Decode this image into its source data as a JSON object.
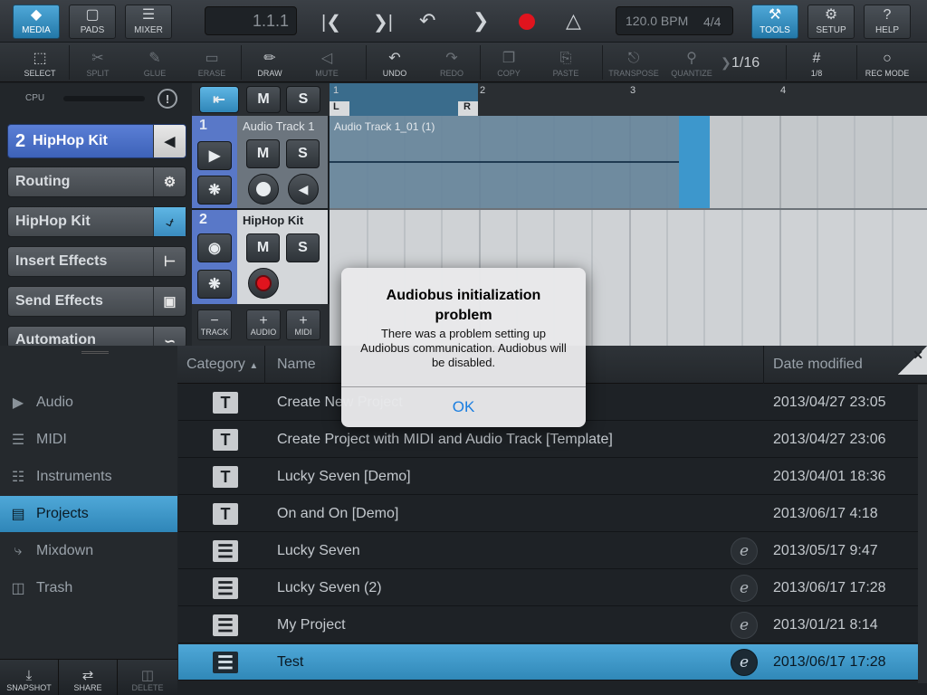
{
  "toolbar": {
    "media": "MEDIA",
    "pads": "PADS",
    "mixer": "MIXER",
    "position": "1.1.1",
    "tempo": "120.0 BPM",
    "signature": "4/4",
    "tools": "TOOLS",
    "setup": "SETUP",
    "help": "HELP"
  },
  "toolbar2": {
    "select": "SELECT",
    "split": "SPLIT",
    "glue": "GLUE",
    "erase": "ERASE",
    "draw": "DRAW",
    "mute": "MUTE",
    "undo": "UNDO",
    "redo": "REDO",
    "copy": "COPY",
    "paste": "PASTE",
    "transpose": "TRANSPOSE",
    "quantize": "QUANTIZE",
    "quantize_value": "1/16",
    "grid_value": "1/8",
    "rec_mode": "REC MODE"
  },
  "left": {
    "cpu": "CPU",
    "track_number": "2",
    "track_name": "HipHop Kit",
    "buttons": [
      "Routing",
      "HipHop Kit",
      "Insert Effects",
      "Send Effects",
      "Automation"
    ]
  },
  "tracks": [
    {
      "number": "1",
      "name": "Audio Track 1"
    },
    {
      "number": "2",
      "name": "HipHop Kit"
    }
  ],
  "track_buttons": {
    "m": "M",
    "s": "S",
    "track": "TRACK",
    "audio": "AUDIO",
    "midi": "MIDI",
    "minus": "−",
    "plus": "+"
  },
  "ruler": {
    "marks": [
      "1",
      "2",
      "3",
      "4"
    ],
    "loop_left": "L",
    "loop_right": "R"
  },
  "clip": {
    "name": "Audio Track 1_01 (1)"
  },
  "browser": {
    "headers": {
      "category": "Category",
      "name": "Name",
      "date": "Date modified"
    },
    "categories": [
      "Audio",
      "MIDI",
      "Instruments",
      "Projects",
      "Mixdown",
      "Trash"
    ],
    "files": [
      {
        "type": "T",
        "name": "Create New Project",
        "date": "2013/04/27 23:05"
      },
      {
        "type": "T",
        "name": "Create Project with MIDI and Audio Track [Template]",
        "date": "2013/04/27 23:06"
      },
      {
        "type": "T",
        "name": "Lucky Seven [Demo]",
        "date": "2013/04/01 18:36"
      },
      {
        "type": "T",
        "name": "On and On [Demo]",
        "date": "2013/06/17 4:18"
      },
      {
        "type": "P",
        "name": "Lucky Seven",
        "date": "2013/05/17 9:47",
        "e": "e"
      },
      {
        "type": "P",
        "name": "Lucky Seven (2)",
        "date": "2013/06/17 17:28",
        "e": "e"
      },
      {
        "type": "P",
        "name": "My Project",
        "date": "2013/01/21 8:14",
        "e": "e"
      },
      {
        "type": "P",
        "name": "Test",
        "date": "2013/06/17 17:28",
        "e": "e"
      }
    ],
    "bottom": {
      "snapshot": "SNAPSHOT",
      "share": "SHARE",
      "delete": "DELETE"
    }
  },
  "dialog": {
    "title": "Audiobus initialization problem",
    "message": "There was a problem setting up Audiobus communication. Audiobus will be disabled.",
    "ok": "OK"
  },
  "colors": {
    "accent": "#3d97cc",
    "track_blue": "#5b7fd6",
    "record": "#e0141e"
  }
}
